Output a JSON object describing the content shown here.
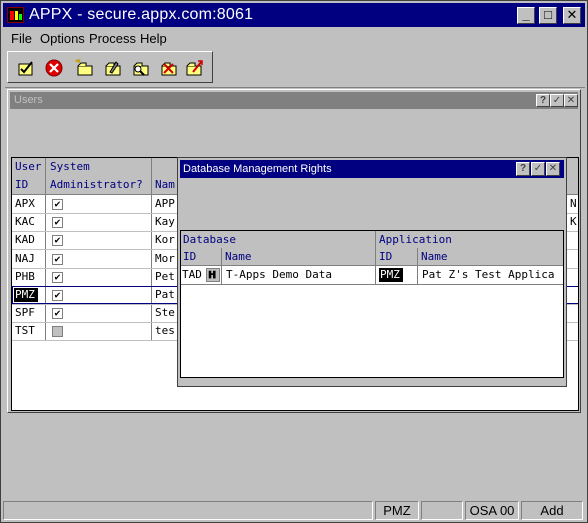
{
  "window": {
    "title": "APPX - secure.appx.com:8061",
    "min_glyph": "_",
    "max_glyph": "□",
    "close_glyph": "✕"
  },
  "menu": [
    "File",
    "Options",
    "Process",
    "Help"
  ],
  "toolbar": [
    {
      "icon": "check-icon"
    },
    {
      "icon": "cancel-icon"
    },
    {
      "icon": "add-record-icon"
    },
    {
      "icon": "change-record-icon"
    },
    {
      "icon": "inquire-record-icon"
    },
    {
      "icon": "delete-record-icon"
    },
    {
      "icon": "recycle-icon"
    }
  ],
  "users_window": {
    "title": "Users",
    "help": "?",
    "ok": "✓",
    "close": "✕",
    "headers": {
      "user_line1": "User",
      "user_line2": "ID",
      "admin_line1": "System",
      "admin_line2": "Administrator?",
      "name": "Nam"
    },
    "rows": [
      {
        "id": "APX",
        "admin": true,
        "name": "APP",
        "tail": "N"
      },
      {
        "id": "KAC",
        "admin": true,
        "name": "Kay",
        "tail": "K"
      },
      {
        "id": "KAD",
        "admin": true,
        "name": "Kor",
        "tail": ""
      },
      {
        "id": "NAJ",
        "admin": true,
        "name": "Mor",
        "tail": ""
      },
      {
        "id": "PHB",
        "admin": true,
        "name": "Pet",
        "tail": ""
      },
      {
        "id": "PMZ",
        "admin": true,
        "name": "Pat",
        "tail": ""
      },
      {
        "id": "SPF",
        "admin": true,
        "name": "Ste",
        "tail": ""
      },
      {
        "id": "TST",
        "admin": false,
        "name": "tes",
        "tail": ""
      }
    ],
    "selected_row": 5
  },
  "dbm_window": {
    "title": "Database Management Rights",
    "help": "?",
    "ok": "✓",
    "close": "✕",
    "headers": {
      "database": "Database",
      "application": "Application",
      "db_id": "ID",
      "db_name": "Name",
      "app_id": "ID",
      "app_name": "Name"
    },
    "rows": [
      {
        "db_id": "TAD",
        "db_name": "T-Apps Demo Data",
        "app_id": "PMZ",
        "app_name": "Pat Z's Test Applica"
      }
    ]
  },
  "status": {
    "user": "PMZ",
    "process": "OSA 00",
    "mode": "Add"
  }
}
